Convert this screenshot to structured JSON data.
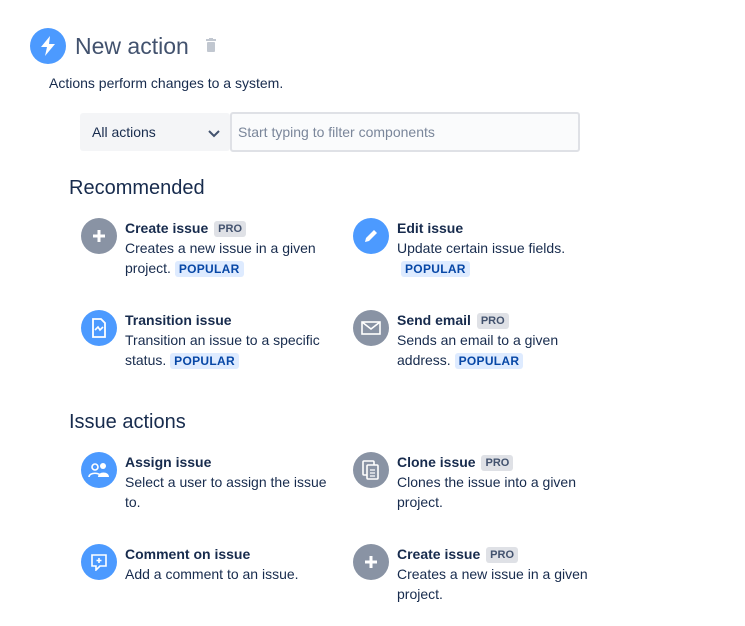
{
  "header": {
    "title": "New action",
    "subtitle": "Actions perform changes to a system.",
    "icon": "lightning-icon",
    "delete_icon": "trash-icon"
  },
  "filter": {
    "select_value": "All actions",
    "placeholder": "Start typing to filter components"
  },
  "sections": [
    {
      "title": "Recommended",
      "items": [
        {
          "name": "Create issue",
          "pro": "PRO",
          "desc": "Creates a new issue in a given project.",
          "popular": "POPULAR",
          "icon": "plus-icon",
          "color": "#8993a4"
        },
        {
          "name": "Edit issue",
          "pro": "",
          "desc": "Update certain issue fields.",
          "popular": "POPULAR",
          "icon": "pencil-icon",
          "color": "#4c9aff"
        },
        {
          "name": "Transition issue",
          "pro": "",
          "desc": "Transition an issue to a specific status.",
          "popular": "POPULAR",
          "icon": "transition-icon",
          "color": "#4c9aff"
        },
        {
          "name": "Send email",
          "pro": "PRO",
          "desc": "Sends an email to a given address.",
          "popular": "POPULAR",
          "icon": "envelope-icon",
          "color": "#8993a4"
        }
      ]
    },
    {
      "title": "Issue actions",
      "items": [
        {
          "name": "Assign issue",
          "pro": "",
          "desc": "Select a user to assign the issue to.",
          "popular": "",
          "icon": "assign-user-icon",
          "color": "#4c9aff"
        },
        {
          "name": "Clone issue",
          "pro": "PRO",
          "desc": "Clones the issue into a given project.",
          "popular": "",
          "icon": "clone-icon",
          "color": "#8993a4"
        },
        {
          "name": "Comment on issue",
          "pro": "",
          "desc": "Add a comment to an issue.",
          "popular": "",
          "icon": "comment-icon",
          "color": "#4c9aff"
        },
        {
          "name": "Create issue",
          "pro": "PRO",
          "desc": "Creates a new issue in a given project.",
          "popular": "",
          "icon": "plus-icon",
          "color": "#8993a4"
        }
      ]
    }
  ]
}
